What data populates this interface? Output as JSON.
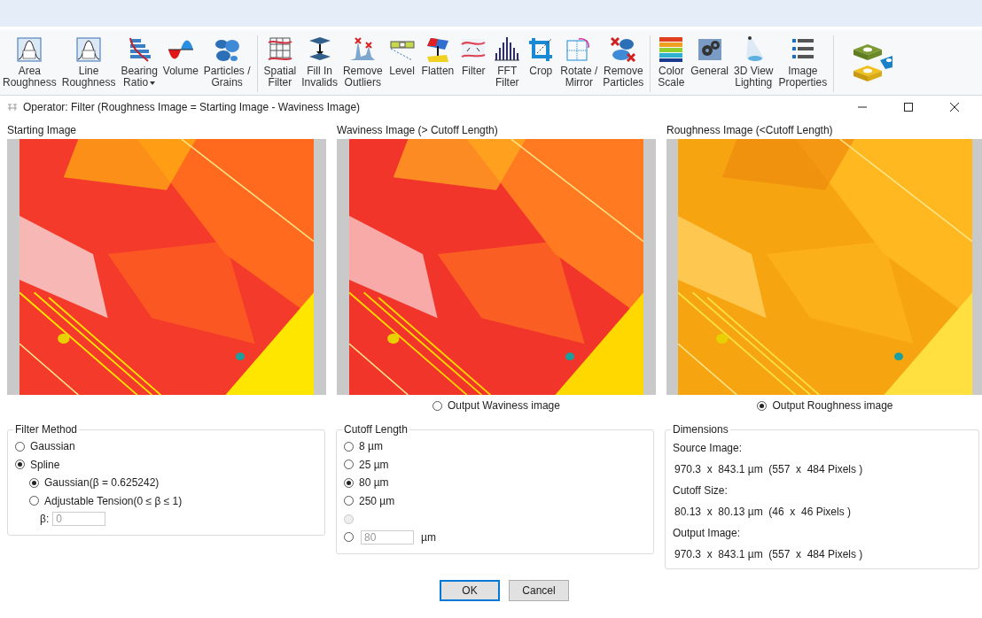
{
  "toolbar": {
    "groups": [
      {
        "items": [
          {
            "label": [
              "Area",
              "Roughness"
            ]
          },
          {
            "label": [
              "Line",
              "Roughness"
            ]
          },
          {
            "label": [
              "Bearing",
              "Ratio"
            ],
            "dropdown": true
          },
          {
            "label": [
              "Volume"
            ]
          },
          {
            "label": [
              "Particles /",
              "Grains"
            ]
          }
        ]
      },
      {
        "items": [
          {
            "label": [
              "Spatial",
              "Filter"
            ]
          },
          {
            "label": [
              "Fill In",
              "Invalids"
            ]
          },
          {
            "label": [
              "Remove",
              "Outliers"
            ]
          },
          {
            "label": [
              "Level"
            ]
          },
          {
            "label": [
              "Flatten"
            ]
          },
          {
            "label": [
              "Filter"
            ]
          },
          {
            "label": [
              "FFT",
              "Filter"
            ]
          },
          {
            "label": [
              "Crop"
            ]
          },
          {
            "label": [
              "Rotate /",
              "Mirror"
            ]
          },
          {
            "label": [
              "Remove",
              "Particles"
            ]
          }
        ]
      },
      {
        "items": [
          {
            "label": [
              "Color",
              "Scale"
            ]
          },
          {
            "label": [
              "General"
            ]
          },
          {
            "label": [
              "3D View",
              "Lighting"
            ]
          },
          {
            "label": [
              "Image",
              "Properties"
            ]
          }
        ]
      }
    ]
  },
  "dialog": {
    "title": "Operator: Filter (Roughness Image = Starting Image - Waviness Image)",
    "panels": [
      {
        "title": "Starting Image"
      },
      {
        "title": "Waviness Image (> Cutoff Length)",
        "output_option": {
          "label": "Output Waviness image",
          "selected": false
        }
      },
      {
        "title": "Roughness Image (<Cutoff Length)",
        "output_option": {
          "label": "Output Roughness image",
          "selected": true
        }
      }
    ],
    "filter_method": {
      "title": "Filter Method",
      "options": [
        {
          "label": "Gaussian",
          "selected": false
        },
        {
          "label": "Spline",
          "selected": true,
          "children": [
            {
              "label": "Gaussian(β = 0.625242)",
              "selected": true
            },
            {
              "label": "Adjustable Tension(0 ≤ β ≤ 1)",
              "selected": false
            }
          ]
        }
      ],
      "beta": {
        "label": "β:",
        "value": "0",
        "disabled": true
      }
    },
    "cutoff_length": {
      "title": "Cutoff Length",
      "options": [
        {
          "kind": "preset",
          "label": "8 µm",
          "selected": false,
          "disabled": false
        },
        {
          "kind": "preset",
          "label": "25 µm",
          "selected": false,
          "disabled": false
        },
        {
          "kind": "preset",
          "label": "80 µm",
          "selected": true,
          "disabled": false
        },
        {
          "kind": "preset",
          "label": "250 µm",
          "selected": false,
          "disabled": false
        },
        {
          "kind": "blank",
          "selected": false,
          "disabled": true
        },
        {
          "kind": "custom",
          "value": "80",
          "unit": "µm",
          "selected": false,
          "disabled": false,
          "field_disabled": true
        }
      ]
    },
    "dimensions": {
      "title": "Dimensions",
      "items": [
        {
          "label": "Source Image:",
          "value": "970.3  x  843.1 µm  (557  x  484 Pixels )"
        },
        {
          "label": "Cutoff Size:",
          "value": "80.13  x  80.13 µm  (46  x  46 Pixels )"
        },
        {
          "label": "Output Image:",
          "value": "970.3  x  843.1 µm  (557  x  484 Pixels )"
        }
      ]
    },
    "buttons": [
      {
        "label": "OK",
        "default": true
      },
      {
        "label": "Cancel",
        "default": false
      }
    ]
  }
}
